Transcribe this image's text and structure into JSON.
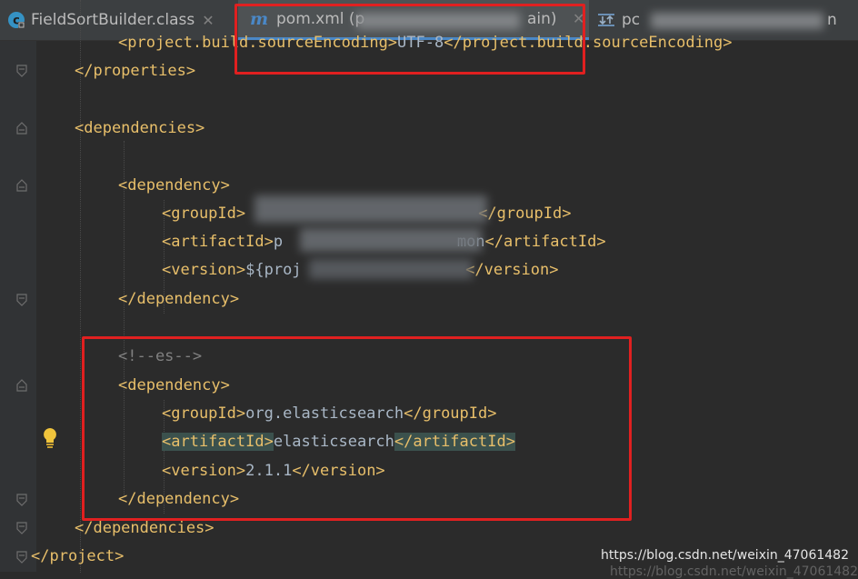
{
  "tabs": [
    {
      "label": "FieldSortBuilder.class",
      "icon": "class-icon",
      "active": false,
      "close": "✕"
    },
    {
      "label": "pom.xml (p",
      "label_tail": "ain)",
      "icon": "maven-icon",
      "active": true,
      "close": "✕"
    },
    {
      "label": "pc",
      "label_tail": "n",
      "icon": "module-icon",
      "active": false
    }
  ],
  "code": {
    "lines": [
      {
        "parts": [
          "<project.build.sourceEncoding>",
          "UTF-8",
          "</project.build.sourceEncoding>"
        ]
      },
      {
        "parts": [
          "</properties>"
        ]
      },
      {
        "parts": [
          "<dependencies>"
        ]
      },
      {
        "parts": [
          "<dependency>"
        ]
      },
      {
        "parts": [
          "<groupId>",
          "",
          "</groupId>"
        ]
      },
      {
        "parts": [
          "<artifactId>",
          "p",
          "mon",
          "</artifactId>"
        ]
      },
      {
        "parts": [
          "<version>",
          "${proj",
          "</version>"
        ]
      },
      {
        "parts": [
          "</dependency>"
        ]
      },
      {
        "parts": [
          "<!--es-->"
        ]
      },
      {
        "parts": [
          "<dependency>"
        ]
      },
      {
        "parts": [
          "<groupId>",
          "org.elasticsearch",
          "</groupId>"
        ]
      },
      {
        "parts": [
          "<artifactId>",
          "elasticsearch",
          "</artifactId>"
        ]
      },
      {
        "parts": [
          "<version>",
          "2.1.1",
          "</version>"
        ]
      },
      {
        "parts": [
          "</dependency>"
        ]
      },
      {
        "parts": [
          "</dependencies>"
        ]
      },
      {
        "parts": [
          "</project>"
        ]
      }
    ]
  },
  "watermark": "https://blog.csdn.net/weixin_47061482",
  "watermark_echo": "https://blog.csdn.net/weixin_47061482",
  "colors": {
    "highlight_box": "#e02020",
    "tag": "#e8bf6a",
    "text": "#a9b7c6",
    "comment": "#808080"
  }
}
